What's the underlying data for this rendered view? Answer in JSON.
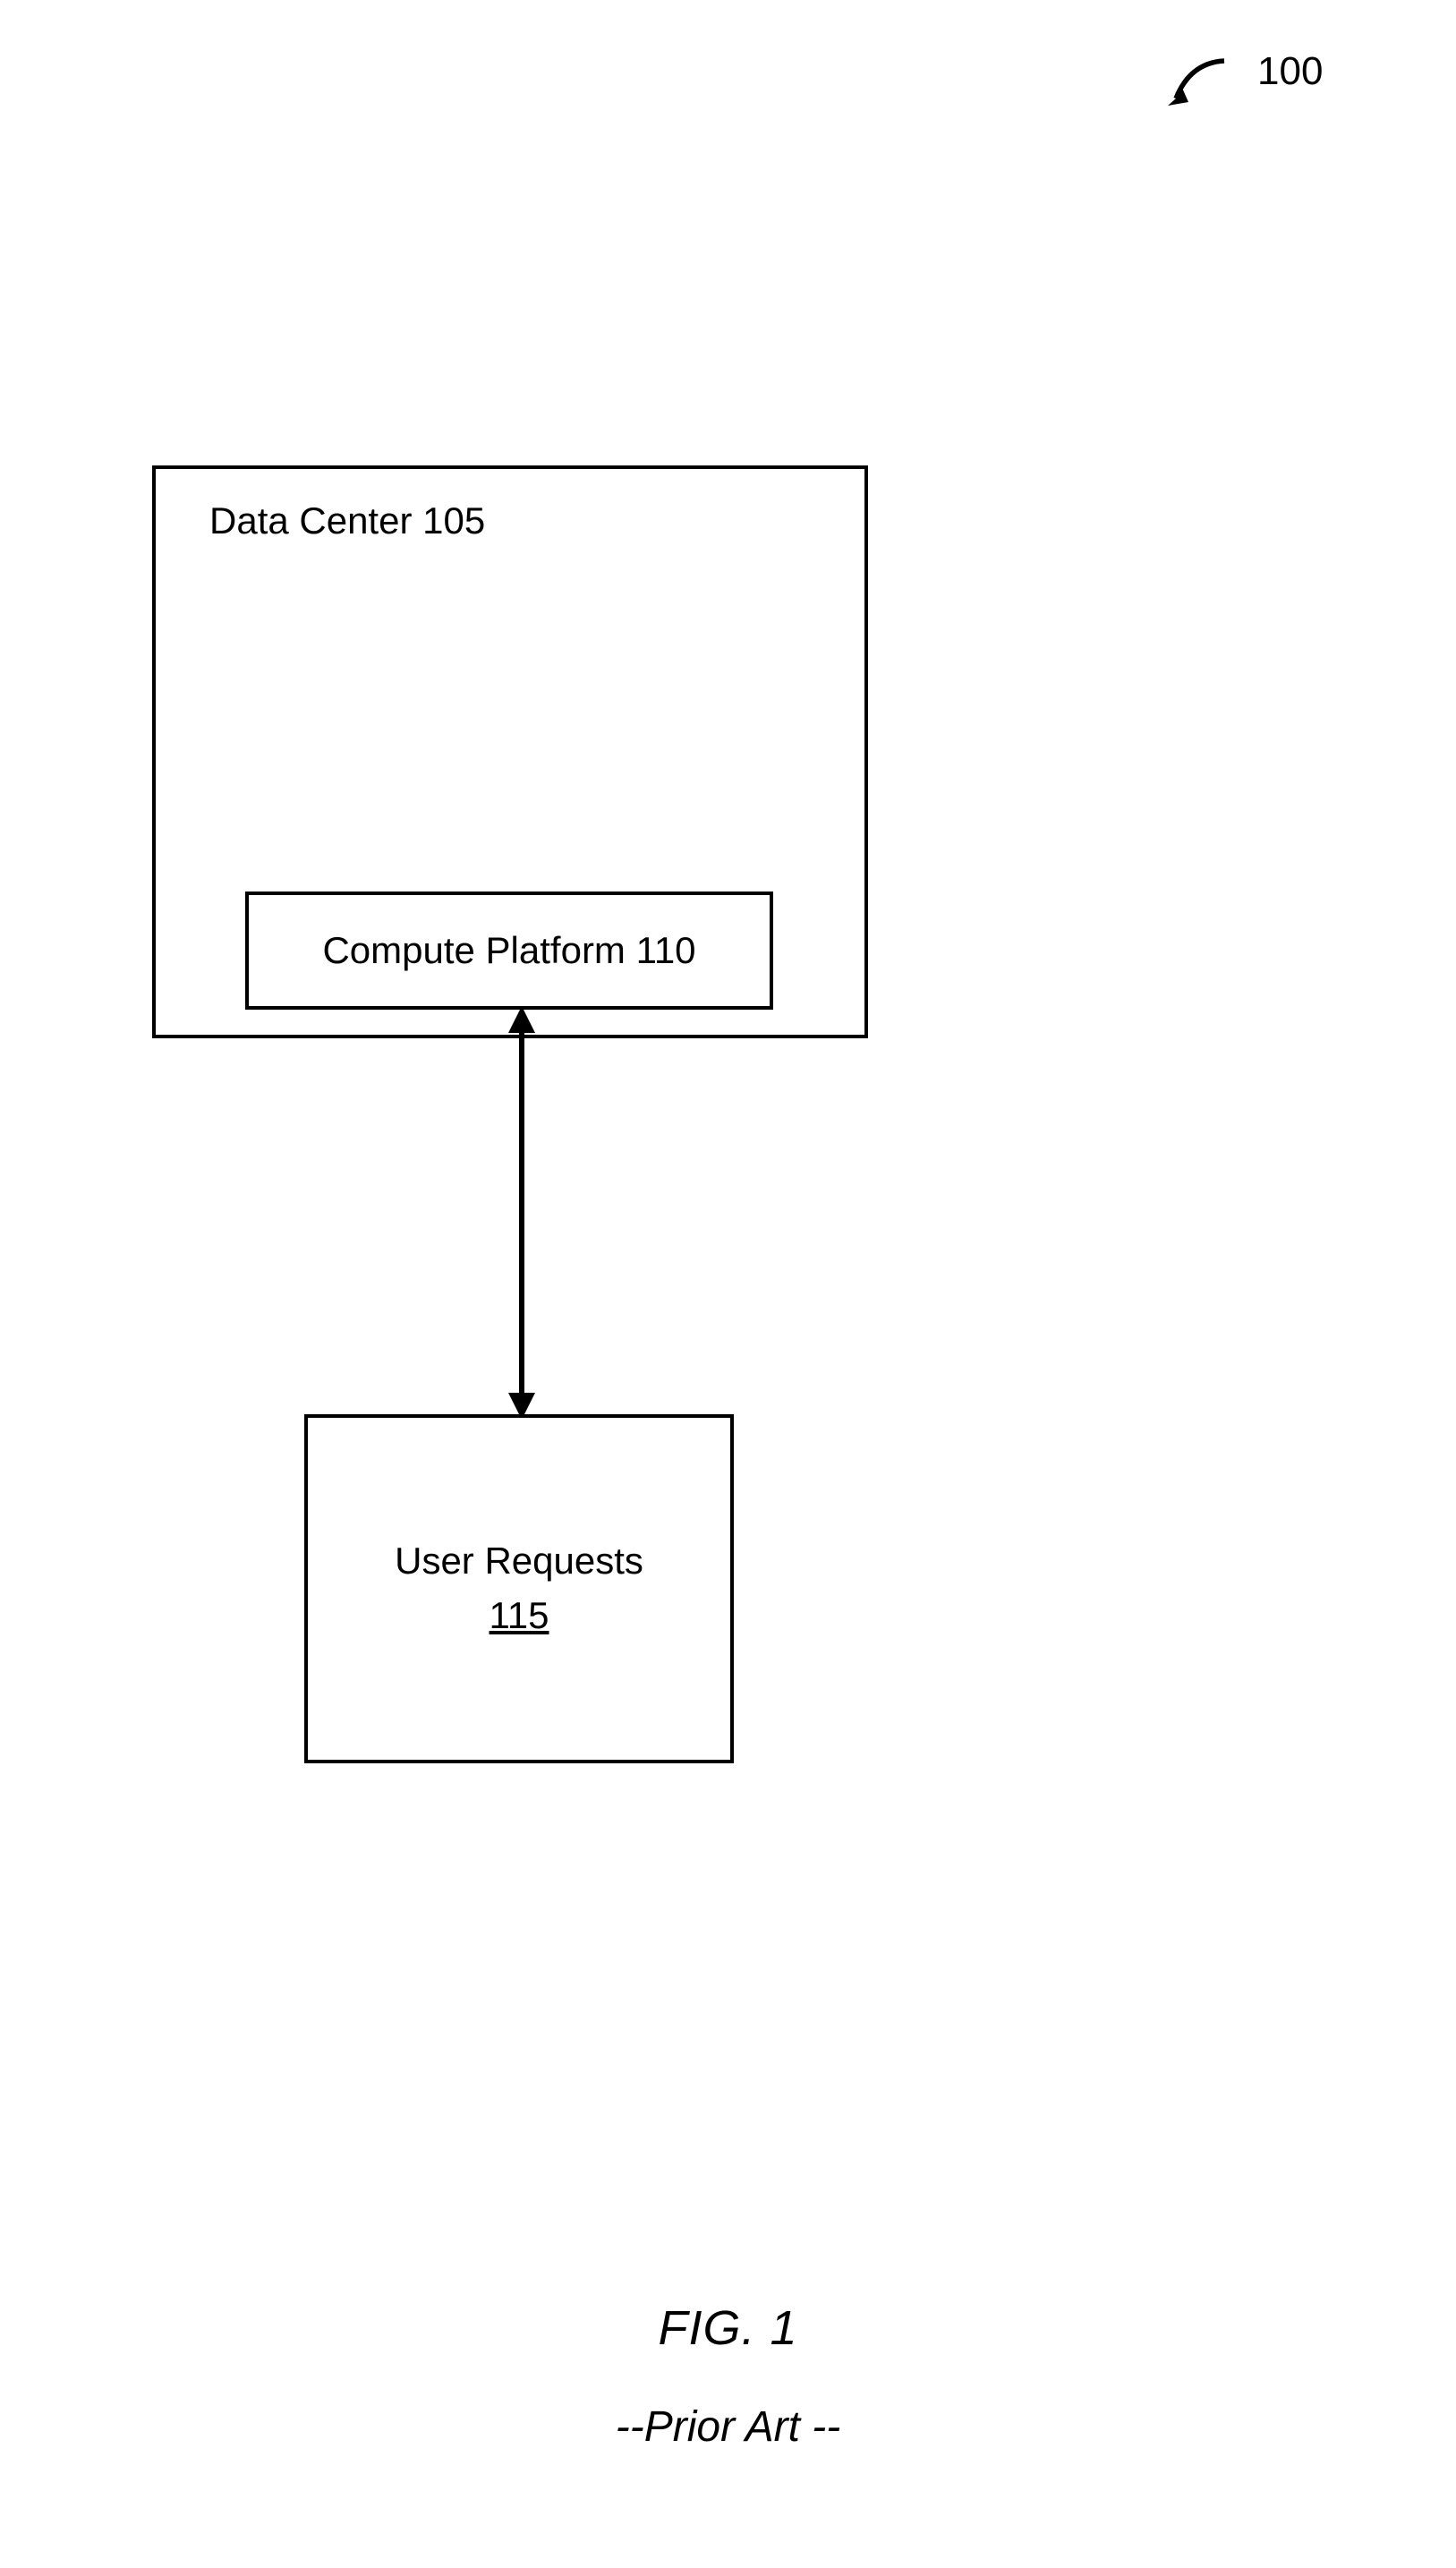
{
  "ref_number": "100",
  "data_center": {
    "label": "Data Center 105"
  },
  "compute_platform": {
    "label": "Compute Platform 110"
  },
  "user_requests": {
    "label": "User Requests",
    "number": "115"
  },
  "figure": {
    "label": "FIG. 1",
    "note": "--Prior Art --"
  }
}
